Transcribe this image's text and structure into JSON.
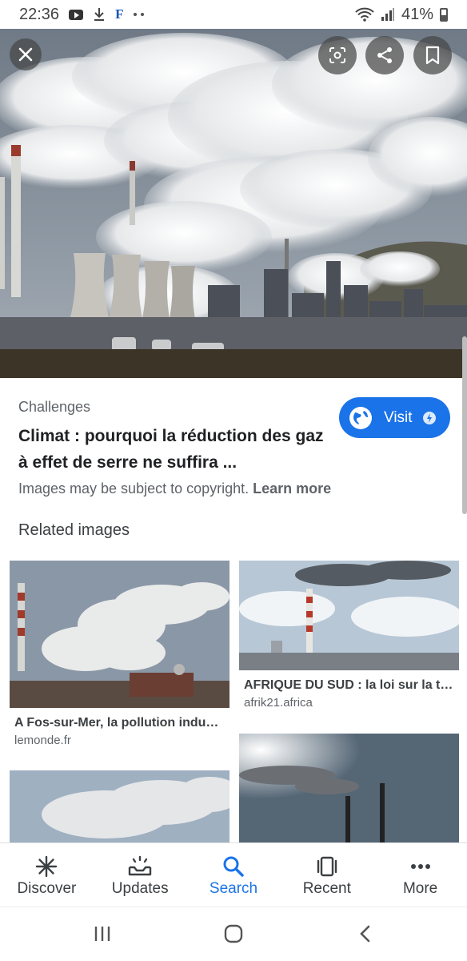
{
  "status_bar": {
    "time": "22:36",
    "battery": "41%",
    "notif_icons": [
      "youtube-icon",
      "download-icon",
      "facebook-f-icon",
      "more-dots-icon"
    ]
  },
  "hero": {
    "icons": {
      "close": "close-icon",
      "lens": "lens-icon",
      "share": "share-icon",
      "save": "bookmark-icon"
    }
  },
  "result": {
    "source": "Challenges",
    "title": "Climat : pourquoi la réduction des gaz à effet de serre ne suffira ...",
    "visit_label": "Visit",
    "copyright_text": "Images may be subject to copyright.",
    "learn_more": "Learn more"
  },
  "related": {
    "heading": "Related images",
    "items": [
      {
        "title": "A Fos-sur-Mer, la pollution indu…",
        "site": "lemonde.fr"
      },
      {
        "title": "AFRIQUE DU SUD : la loi sur la t…",
        "site": "afrik21.africa"
      },
      {
        "title": "",
        "site": ""
      },
      {
        "title": "",
        "site": ""
      }
    ]
  },
  "bottom_nav": {
    "items": [
      {
        "label": "Discover",
        "icon": "asterisk-icon"
      },
      {
        "label": "Updates",
        "icon": "updates-icon"
      },
      {
        "label": "Search",
        "icon": "search-icon",
        "active": true
      },
      {
        "label": "Recent",
        "icon": "recent-icon"
      },
      {
        "label": "More",
        "icon": "more-icon"
      }
    ]
  },
  "colors": {
    "accent": "#1a73e8",
    "text_primary": "#202124",
    "text_secondary": "#5f6368"
  }
}
